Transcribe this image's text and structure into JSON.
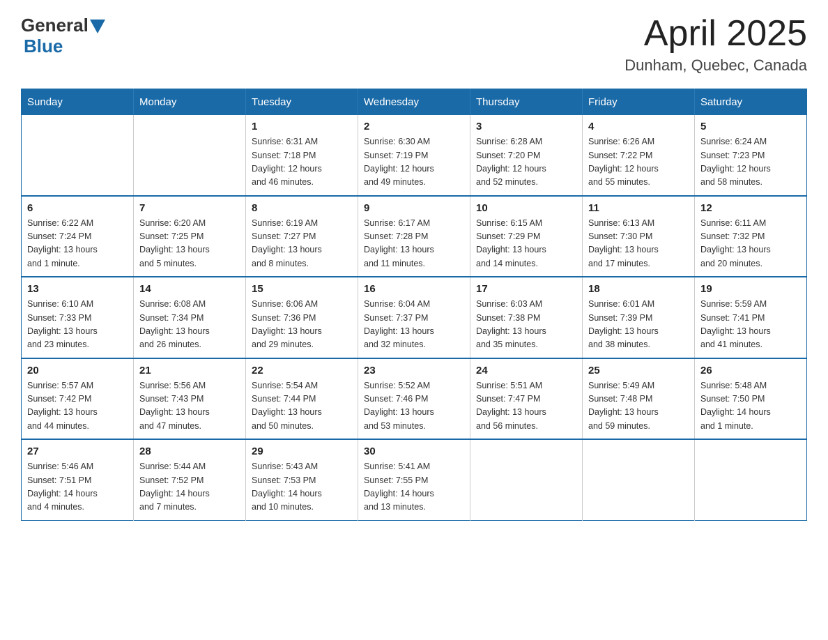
{
  "header": {
    "logo_general": "General",
    "logo_blue": "Blue",
    "title": "April 2025",
    "subtitle": "Dunham, Quebec, Canada"
  },
  "calendar": {
    "days_of_week": [
      "Sunday",
      "Monday",
      "Tuesday",
      "Wednesday",
      "Thursday",
      "Friday",
      "Saturday"
    ],
    "weeks": [
      {
        "days": [
          {
            "number": "",
            "info": ""
          },
          {
            "number": "",
            "info": ""
          },
          {
            "number": "1",
            "info": "Sunrise: 6:31 AM\nSunset: 7:18 PM\nDaylight: 12 hours\nand 46 minutes."
          },
          {
            "number": "2",
            "info": "Sunrise: 6:30 AM\nSunset: 7:19 PM\nDaylight: 12 hours\nand 49 minutes."
          },
          {
            "number": "3",
            "info": "Sunrise: 6:28 AM\nSunset: 7:20 PM\nDaylight: 12 hours\nand 52 minutes."
          },
          {
            "number": "4",
            "info": "Sunrise: 6:26 AM\nSunset: 7:22 PM\nDaylight: 12 hours\nand 55 minutes."
          },
          {
            "number": "5",
            "info": "Sunrise: 6:24 AM\nSunset: 7:23 PM\nDaylight: 12 hours\nand 58 minutes."
          }
        ]
      },
      {
        "days": [
          {
            "number": "6",
            "info": "Sunrise: 6:22 AM\nSunset: 7:24 PM\nDaylight: 13 hours\nand 1 minute."
          },
          {
            "number": "7",
            "info": "Sunrise: 6:20 AM\nSunset: 7:25 PM\nDaylight: 13 hours\nand 5 minutes."
          },
          {
            "number": "8",
            "info": "Sunrise: 6:19 AM\nSunset: 7:27 PM\nDaylight: 13 hours\nand 8 minutes."
          },
          {
            "number": "9",
            "info": "Sunrise: 6:17 AM\nSunset: 7:28 PM\nDaylight: 13 hours\nand 11 minutes."
          },
          {
            "number": "10",
            "info": "Sunrise: 6:15 AM\nSunset: 7:29 PM\nDaylight: 13 hours\nand 14 minutes."
          },
          {
            "number": "11",
            "info": "Sunrise: 6:13 AM\nSunset: 7:30 PM\nDaylight: 13 hours\nand 17 minutes."
          },
          {
            "number": "12",
            "info": "Sunrise: 6:11 AM\nSunset: 7:32 PM\nDaylight: 13 hours\nand 20 minutes."
          }
        ]
      },
      {
        "days": [
          {
            "number": "13",
            "info": "Sunrise: 6:10 AM\nSunset: 7:33 PM\nDaylight: 13 hours\nand 23 minutes."
          },
          {
            "number": "14",
            "info": "Sunrise: 6:08 AM\nSunset: 7:34 PM\nDaylight: 13 hours\nand 26 minutes."
          },
          {
            "number": "15",
            "info": "Sunrise: 6:06 AM\nSunset: 7:36 PM\nDaylight: 13 hours\nand 29 minutes."
          },
          {
            "number": "16",
            "info": "Sunrise: 6:04 AM\nSunset: 7:37 PM\nDaylight: 13 hours\nand 32 minutes."
          },
          {
            "number": "17",
            "info": "Sunrise: 6:03 AM\nSunset: 7:38 PM\nDaylight: 13 hours\nand 35 minutes."
          },
          {
            "number": "18",
            "info": "Sunrise: 6:01 AM\nSunset: 7:39 PM\nDaylight: 13 hours\nand 38 minutes."
          },
          {
            "number": "19",
            "info": "Sunrise: 5:59 AM\nSunset: 7:41 PM\nDaylight: 13 hours\nand 41 minutes."
          }
        ]
      },
      {
        "days": [
          {
            "number": "20",
            "info": "Sunrise: 5:57 AM\nSunset: 7:42 PM\nDaylight: 13 hours\nand 44 minutes."
          },
          {
            "number": "21",
            "info": "Sunrise: 5:56 AM\nSunset: 7:43 PM\nDaylight: 13 hours\nand 47 minutes."
          },
          {
            "number": "22",
            "info": "Sunrise: 5:54 AM\nSunset: 7:44 PM\nDaylight: 13 hours\nand 50 minutes."
          },
          {
            "number": "23",
            "info": "Sunrise: 5:52 AM\nSunset: 7:46 PM\nDaylight: 13 hours\nand 53 minutes."
          },
          {
            "number": "24",
            "info": "Sunrise: 5:51 AM\nSunset: 7:47 PM\nDaylight: 13 hours\nand 56 minutes."
          },
          {
            "number": "25",
            "info": "Sunrise: 5:49 AM\nSunset: 7:48 PM\nDaylight: 13 hours\nand 59 minutes."
          },
          {
            "number": "26",
            "info": "Sunrise: 5:48 AM\nSunset: 7:50 PM\nDaylight: 14 hours\nand 1 minute."
          }
        ]
      },
      {
        "days": [
          {
            "number": "27",
            "info": "Sunrise: 5:46 AM\nSunset: 7:51 PM\nDaylight: 14 hours\nand 4 minutes."
          },
          {
            "number": "28",
            "info": "Sunrise: 5:44 AM\nSunset: 7:52 PM\nDaylight: 14 hours\nand 7 minutes."
          },
          {
            "number": "29",
            "info": "Sunrise: 5:43 AM\nSunset: 7:53 PM\nDaylight: 14 hours\nand 10 minutes."
          },
          {
            "number": "30",
            "info": "Sunrise: 5:41 AM\nSunset: 7:55 PM\nDaylight: 14 hours\nand 13 minutes."
          },
          {
            "number": "",
            "info": ""
          },
          {
            "number": "",
            "info": ""
          },
          {
            "number": "",
            "info": ""
          }
        ]
      }
    ]
  }
}
